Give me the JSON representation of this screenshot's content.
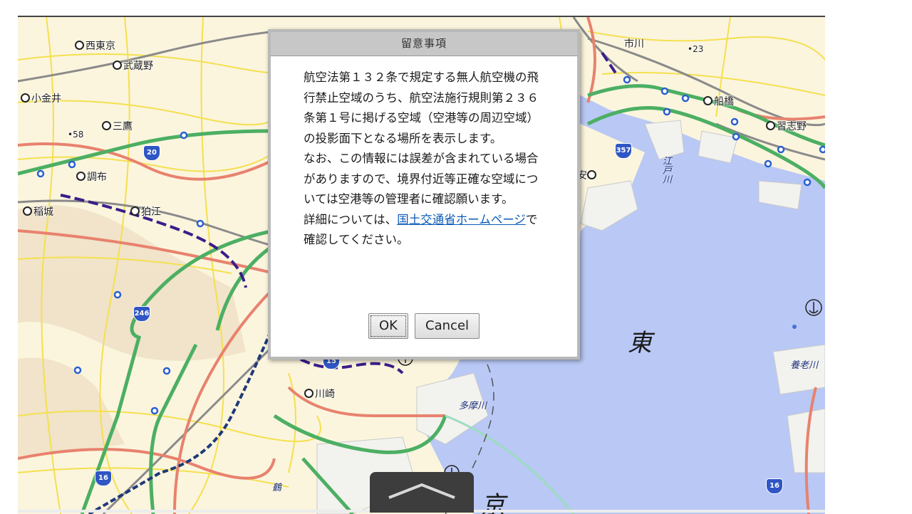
{
  "map": {
    "places": [
      {
        "id": "nishitokyo",
        "label": "西東京"
      },
      {
        "id": "musashino",
        "label": "武蔵野"
      },
      {
        "id": "koganei",
        "label": "小金井"
      },
      {
        "id": "mitaka",
        "label": "三鷹"
      },
      {
        "id": "chofu",
        "label": "調布"
      },
      {
        "id": "inagi",
        "label": "稲城"
      },
      {
        "id": "komae",
        "label": "狛江"
      },
      {
        "id": "ichikawa",
        "label": "市川"
      },
      {
        "id": "funabashi",
        "label": "船橋"
      },
      {
        "id": "narashino",
        "label": "習志野"
      },
      {
        "id": "kawasaki",
        "label": "川崎"
      },
      {
        "id": "urayasu",
        "label": "安"
      }
    ],
    "elevation_labels": [
      "58",
      "23"
    ],
    "routes": [
      "20",
      "246",
      "357",
      "16",
      "16",
      "15"
    ],
    "rivers": [
      "江戸川",
      "多摩川",
      "養老川",
      "鶴"
    ],
    "large_labels": [
      "東",
      "京"
    ],
    "colors": {
      "water": "#b9c8f5",
      "land": "#fbf5de",
      "rail": "#4caf63",
      "road_major": "#e8826e",
      "road_minor": "#f4e04f"
    }
  },
  "dialog": {
    "title": "留意事項",
    "paragraph1": "航空法第１３２条で規定する無人航空機の飛行禁止空域のうち、航空法施行規則第２３６条第１号に掲げる空域（空港等の周辺空域）の投影面下となる場所を表示します。",
    "paragraph2": "なお、この情報には誤差が含まれている場合がありますので、境界付近等正確な空域については空港等の管理者に確認願います。",
    "paragraph3_prefix": "詳細については、",
    "link_text": "国土交通省ホームページ",
    "paragraph3_suffix": "で確認してください。",
    "ok_label": "OK",
    "cancel_label": "Cancel"
  },
  "panel_toggle": {
    "icon": "chevron-up-icon"
  }
}
